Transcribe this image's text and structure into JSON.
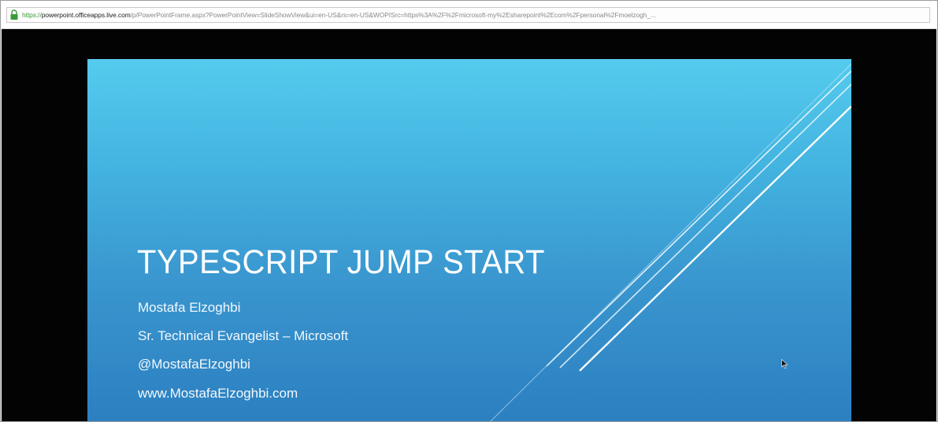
{
  "browser": {
    "url": {
      "scheme": "https://",
      "host": "powerpoint.officeapps.live.com",
      "path": "/p/PowerPointFrame.aspx?PowerPointView=SlideShowView&ui=en-US&rs=en-US&WOPISrc=https%3A%2F%2Fmicrosoft-my%2Esharepoint%2Ecom%2Fpersonal%2Fmoelzogh_..."
    },
    "lock_icon": "lock-icon"
  },
  "slide": {
    "title": "TYPESCRIPT JUMP START",
    "lines": [
      "Mostafa Elzoghbi",
      "Sr. Technical Evangelist – Microsoft",
      "@MostafaElzoghbi",
      "www.MostafaElzoghbi.com"
    ],
    "colors": {
      "gradient_top": "#55cbee",
      "gradient_bottom": "#2c7fc0",
      "text": "#ffffff",
      "background": "#030303"
    }
  },
  "cursor_icon": "mouse-pointer-icon"
}
